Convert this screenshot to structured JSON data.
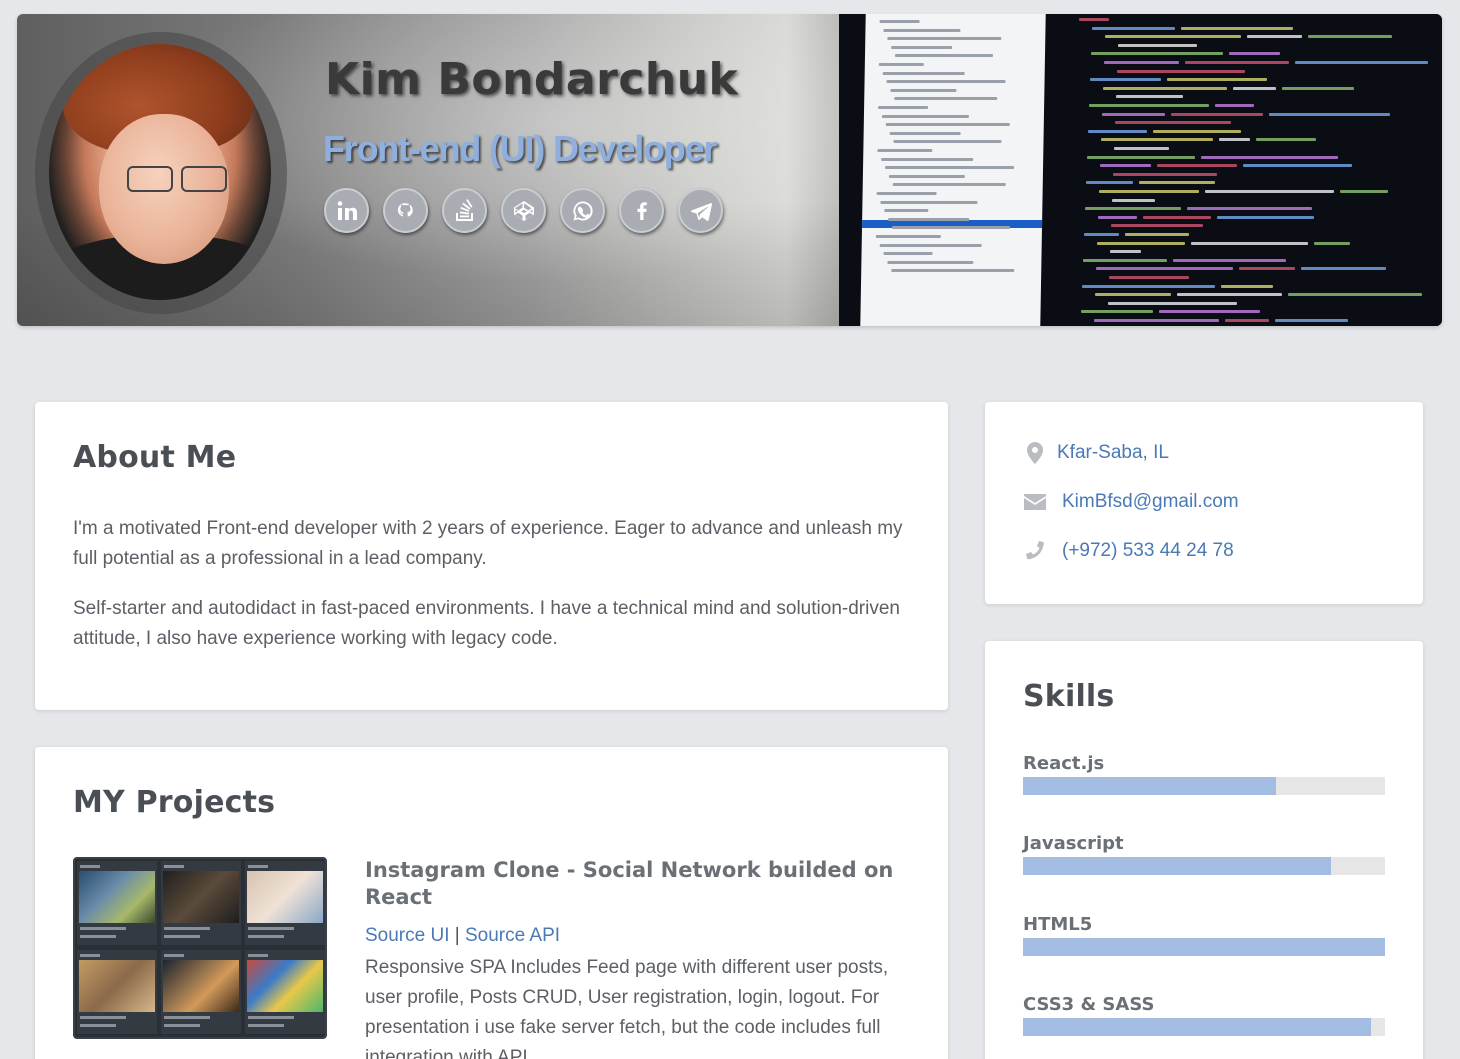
{
  "header": {
    "name": "Kim Bondarchuk",
    "role": "Front-end (UI) Developer",
    "socials": [
      {
        "icon": "linkedin-icon"
      },
      {
        "icon": "github-icon"
      },
      {
        "icon": "stackoverflow-icon"
      },
      {
        "icon": "codepen-icon"
      },
      {
        "icon": "whatsapp-icon"
      },
      {
        "icon": "facebook-icon"
      },
      {
        "icon": "telegram-icon"
      }
    ]
  },
  "about": {
    "title": "About Me",
    "p1": "I'm a motivated Front-end developer with 2 years of experience. Eager to advance and unleash my full potential as a professional in a lead company.",
    "p2": "Self-starter and autodidact in fast-paced environments. I have a technical mind and solution-driven attitude, I also have experience working with legacy code."
  },
  "projects": {
    "title": "MY Projects",
    "items": [
      {
        "title": "Instagram Clone - Social Network builded on React",
        "link_ui": "Source UI",
        "separator": "|",
        "link_api": "Source API",
        "description": "Responsive SPA Includes Feed page with different user posts, user profile, Posts CRUD, User registration, login, logout. For presentation i use fake server fetch, but the code includes full integration with API"
      }
    ]
  },
  "contact": {
    "location": "Kfar-Saba, IL",
    "email": "KimBfsd@gmail.com",
    "phone": "(+972) 533 44 24 78"
  },
  "skills": {
    "title": "Skills",
    "items": [
      {
        "name": "React.js",
        "level": 0.7
      },
      {
        "name": "Javascript",
        "level": 0.85
      },
      {
        "name": "HTML5",
        "level": 1.0
      },
      {
        "name": "CSS3 & SASS",
        "level": 0.96
      }
    ]
  },
  "colors": {
    "accent": "#4b79b6",
    "skill_fill": "#a3bde2",
    "role_text": "#8fb0de",
    "background": "#e5e7ea"
  }
}
